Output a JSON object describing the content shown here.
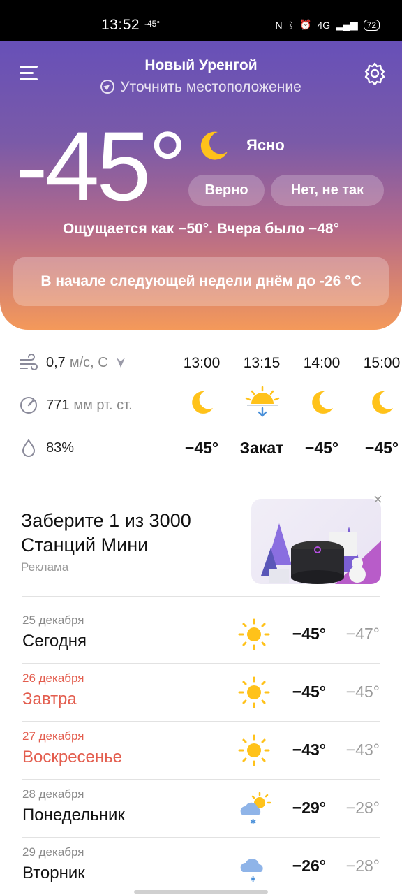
{
  "status_bar": {
    "time": "13:52",
    "temp": "-45°",
    "network": "4G",
    "battery": "72"
  },
  "header": {
    "city": "Новый Уренгой",
    "location_hint": "Уточнить местоположение"
  },
  "current": {
    "temperature": "-45°",
    "condition": "Ясно",
    "correct_label": "Верно",
    "wrong_label": "Нет, не так",
    "feels_like": "Ощущается как −50°. Вчера было −48°",
    "alert": "В начале следующей недели днём до -26 °C"
  },
  "details": {
    "wind_value": "0,7",
    "wind_unit": "м/с, С",
    "pressure_value": "771",
    "pressure_unit": "мм рт. ст.",
    "humidity_value": "83%"
  },
  "hourly": [
    {
      "time": "13:00",
      "icon": "moon-icon",
      "value": "−45°"
    },
    {
      "time": "13:15",
      "icon": "sunset-icon",
      "value": "Закат"
    },
    {
      "time": "14:00",
      "icon": "moon-icon",
      "value": "−45°"
    },
    {
      "time": "15:00",
      "icon": "moon-icon",
      "value": "−45°"
    }
  ],
  "ad": {
    "title": "Заберите 1 из 3000 Станций Мини",
    "label": "Реклама"
  },
  "daily": [
    {
      "date": "25 декабря",
      "name": "Сегодня",
      "icon": "sun-icon",
      "max": "−45°",
      "min": "−47°",
      "weekend": false
    },
    {
      "date": "26 декабря",
      "name": "Завтра",
      "icon": "sun-icon",
      "max": "−45°",
      "min": "−45°",
      "weekend": true
    },
    {
      "date": "27 декабря",
      "name": "Воскресенье",
      "icon": "sun-icon",
      "max": "−43°",
      "min": "−43°",
      "weekend": true
    },
    {
      "date": "28 декабря",
      "name": "Понедельник",
      "icon": "partly-cloudy-snow-icon",
      "max": "−29°",
      "min": "−28°",
      "weekend": false
    },
    {
      "date": "29 декабря",
      "name": "Вторник",
      "icon": "cloud-snow-icon",
      "max": "−26°",
      "min": "−28°",
      "weekend": false
    }
  ],
  "colors": {
    "accent_red": "#e35d4e",
    "gradient_top": "#6750b8",
    "gradient_bottom": "#f4995a",
    "sun": "#ffc21a"
  }
}
